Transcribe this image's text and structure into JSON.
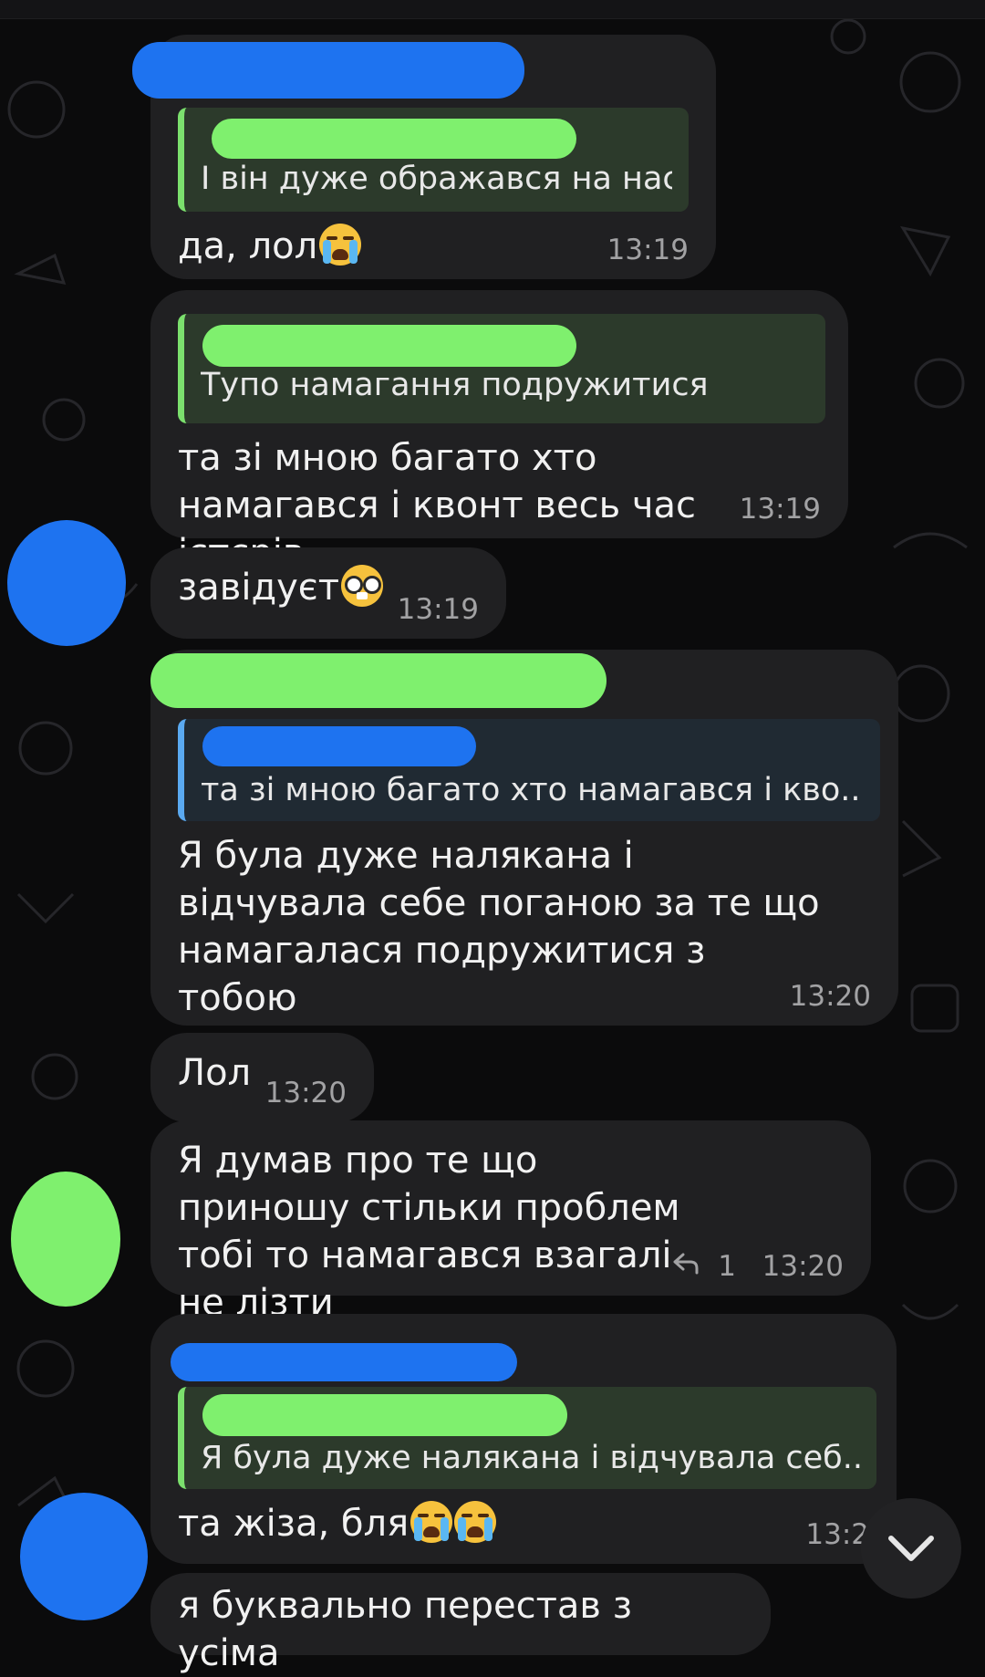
{
  "messages": [
    {
      "quote": "І він дуже ображався на нас",
      "text": "да, лол",
      "time": "13:19"
    },
    {
      "quote": "Тупо намагання подружитися",
      "text": "та зі мною багато хто намагався і квонт весь час істєрів",
      "time": "13:19"
    },
    {
      "text": "завідуєт",
      "time": "13:19"
    },
    {
      "quote": "та зі мною багато хто намагався і кво...",
      "text": "Я була дуже налякана і відчувала себе поганою за те що намагалася подружитися з тобою",
      "time": "13:20"
    },
    {
      "text": "Лол",
      "time": "13:20"
    },
    {
      "text": "Я думав про те що приношу стільки проблем тобі то намагався взагалі не лізти",
      "time": "13:20",
      "replies": "1"
    },
    {
      "quote": "Я була дуже налякана і відчувала себ...",
      "text": "та жіза, бля",
      "time": "13:2"
    },
    {
      "text": "я буквально перестав з усіма"
    }
  ],
  "icons": {
    "reply": "reply-arrow-icon",
    "scroll": "chevron-down-icon",
    "emoji_cry": "loudly-crying-face-emoji",
    "emoji_nerd": "nerd-face-emoji"
  },
  "colors": {
    "background": "#0b0b0c",
    "bubble": "#202022",
    "quote_green": "#7be06d",
    "quote_blue": "#5aa9f0",
    "censor_green": "#7ff06e",
    "censor_blue": "#1e73f0"
  }
}
